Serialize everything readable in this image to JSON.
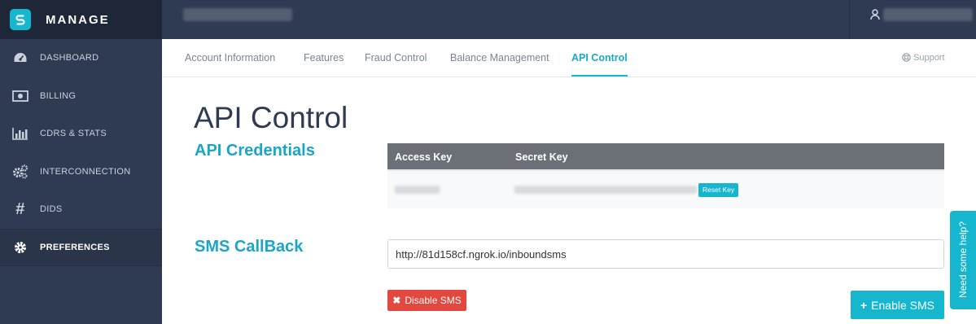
{
  "brand": {
    "name": "MANAGE"
  },
  "sidebar": {
    "items": [
      {
        "label": "DASHBOARD",
        "icon": "dashboard-icon"
      },
      {
        "label": "BILLING",
        "icon": "billing-icon"
      },
      {
        "label": "CDRS & STATS",
        "icon": "bar-chart-icon"
      },
      {
        "label": "INTERCONNECTION",
        "icon": "gears-icon"
      },
      {
        "label": "DIDS",
        "icon": "hash-icon"
      },
      {
        "label": "PREFERENCES",
        "icon": "gear-icon",
        "active": true
      }
    ]
  },
  "tabs": [
    {
      "label": "Account Information"
    },
    {
      "label": "Features"
    },
    {
      "label": "Fraud Control"
    },
    {
      "label": "Balance Management"
    },
    {
      "label": "API Control",
      "active": true
    }
  ],
  "support": {
    "label": "Support"
  },
  "main": {
    "title": "API Control",
    "credentials": {
      "heading": "API Credentials",
      "columns": [
        "Access Key",
        "Secret Key"
      ],
      "reset_label": "Reset Key"
    },
    "sms": {
      "heading": "SMS CallBack",
      "callback_url": "http://81d158cf.ngrok.io/inboundsms",
      "disable_label": "Disable SMS",
      "enable_label": "Enable SMS"
    }
  },
  "help": {
    "label": "Need some help?"
  },
  "colors": {
    "accent": "#17b6cf",
    "sidebar": "#2f3b52",
    "danger": "#e2483d"
  }
}
